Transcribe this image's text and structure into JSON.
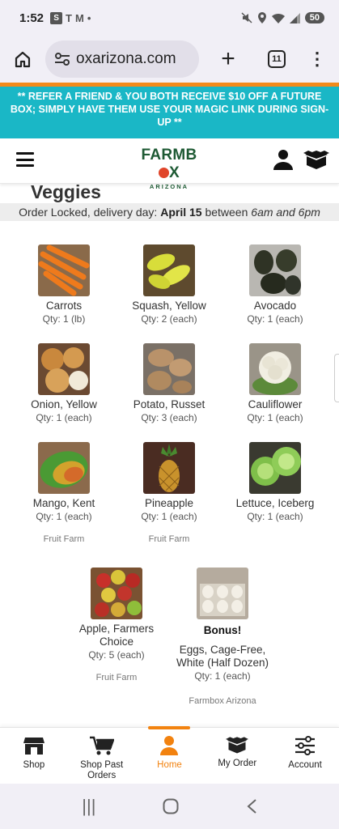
{
  "status_bar": {
    "time": "1:52",
    "left_icons": [
      "S",
      "T",
      "M",
      "•"
    ],
    "battery": "50"
  },
  "browser": {
    "url": "oxarizona.com",
    "tab_count": "11"
  },
  "promo_text": "** REFER A FRIEND & YOU BOTH RECEIVE $10 OFF A FUTURE BOX; SIMPLY HAVE THEM USE YOUR MAGIC LINK DURING SIGN-UP **",
  "logo": {
    "main_left": "FARMB",
    "main_right": "X",
    "sub": "ARIZONA"
  },
  "section": {
    "title": "Veggies",
    "locked_prefix": "Order Locked, delivery day:",
    "delivery_day": "April 15",
    "between": "between",
    "time_start": "6am and 6pm"
  },
  "items": [
    {
      "name": "Carrots",
      "qty": "Qty: 1 (lb)",
      "farm": ""
    },
    {
      "name": "Squash, Yellow",
      "qty": "Qty: 2 (each)",
      "farm": ""
    },
    {
      "name": "Avocado",
      "qty": "Qty: 1 (each)",
      "farm": ""
    },
    {
      "name": "Onion, Yellow",
      "qty": "Qty: 1 (each)",
      "farm": ""
    },
    {
      "name": "Potato, Russet",
      "qty": "Qty: 3 (each)",
      "farm": ""
    },
    {
      "name": "Cauliflower",
      "qty": "Qty: 1 (each)",
      "farm": ""
    },
    {
      "name": "Mango, Kent",
      "qty": "Qty: 1 (each)",
      "farm": "Fruit Farm"
    },
    {
      "name": "Pineapple",
      "qty": "Qty: 1 (each)",
      "farm": "Fruit Farm"
    },
    {
      "name": "Lettuce, Iceberg",
      "qty": "Qty: 1 (each)",
      "farm": ""
    },
    {
      "name": "Apple, Farmers Choice",
      "qty": "Qty: 5 (each)",
      "farm": "Fruit Farm"
    },
    {
      "name": "Eggs, Cage-Free, White (Half Dozen)",
      "bonus": "Bonus!",
      "qty": "Qty: 1 (each)",
      "farm": "Farmbox Arizona"
    }
  ],
  "bottom_nav": [
    {
      "label": "Shop"
    },
    {
      "label": "Shop Past Orders"
    },
    {
      "label": "Home",
      "active": true
    },
    {
      "label": "My Order"
    },
    {
      "label": "Account"
    }
  ],
  "colors": {
    "accent": "#f2820f",
    "promo_bg": "#1ab7c6",
    "logo_green": "#1e5a34"
  },
  "icons": {
    "browser": [
      "home-icon",
      "site-settings-icon",
      "new-tab-icon",
      "tabs-icon",
      "more-menu-icon"
    ],
    "header": [
      "hamburger-menu-icon",
      "user-icon",
      "box-icon"
    ],
    "bottom_nav": [
      "shop-icon",
      "cart-icon",
      "home-person-icon",
      "box-icon",
      "sliders-icon"
    ],
    "android": [
      "recents-icon",
      "home-circle-icon",
      "back-icon"
    ]
  }
}
